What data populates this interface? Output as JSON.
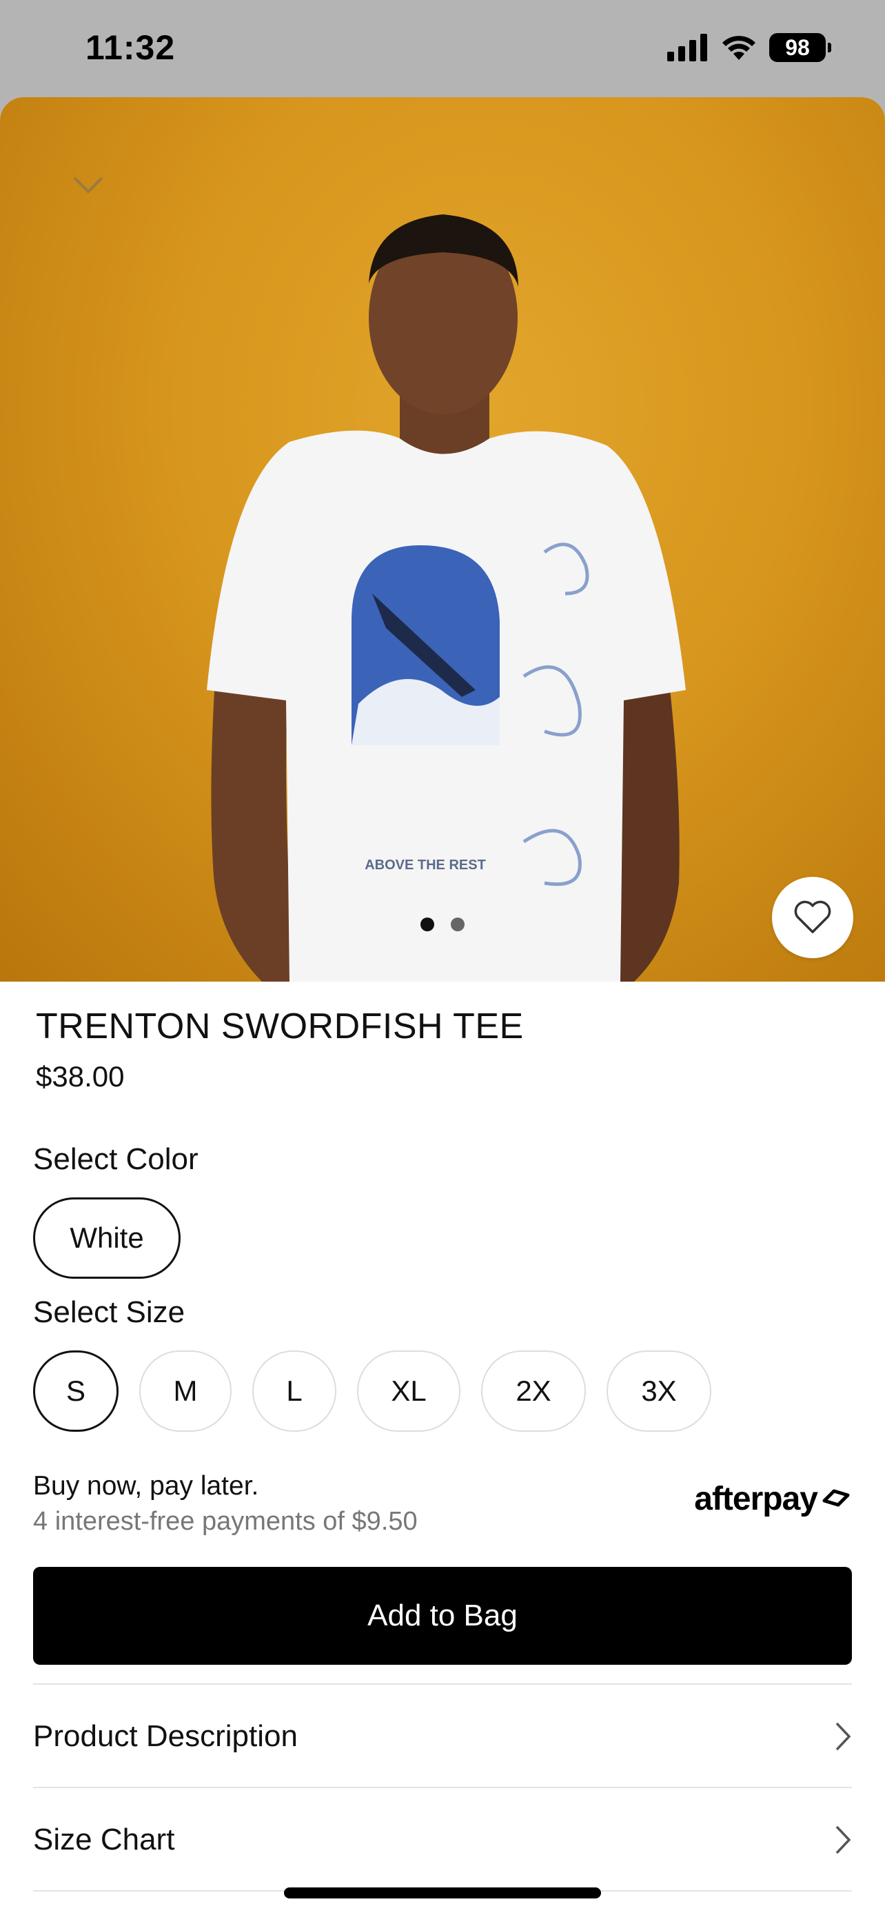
{
  "status": {
    "time": "11:32",
    "battery": "98"
  },
  "hero": {
    "image_alt": "Model wearing white swordfish graphic tee",
    "dots_total": 2,
    "dots_active": 0
  },
  "product": {
    "title": "TRENTON SWORDFISH TEE",
    "price": "$38.00"
  },
  "color": {
    "label": "Select Color",
    "options": [
      "White"
    ],
    "selected": "White"
  },
  "size": {
    "label": "Select Size",
    "options": [
      "S",
      "M",
      "L",
      "XL",
      "2X",
      "3X"
    ],
    "selected": "S"
  },
  "afterpay": {
    "line1": "Buy now, pay later.",
    "line2": "4 interest-free payments of $9.50",
    "logo": "afterpay"
  },
  "actions": {
    "add_to_bag": "Add to Bag"
  },
  "sections": [
    {
      "label": "Product Description"
    },
    {
      "label": "Size Chart"
    }
  ],
  "colors": {
    "hero_bg": "#d7961d",
    "primary": "#000000",
    "border": "#dddddd"
  },
  "icons": {
    "collapse": "chevron-down-icon",
    "favorite": "heart-icon",
    "row_arrow": "chevron-right-icon"
  }
}
